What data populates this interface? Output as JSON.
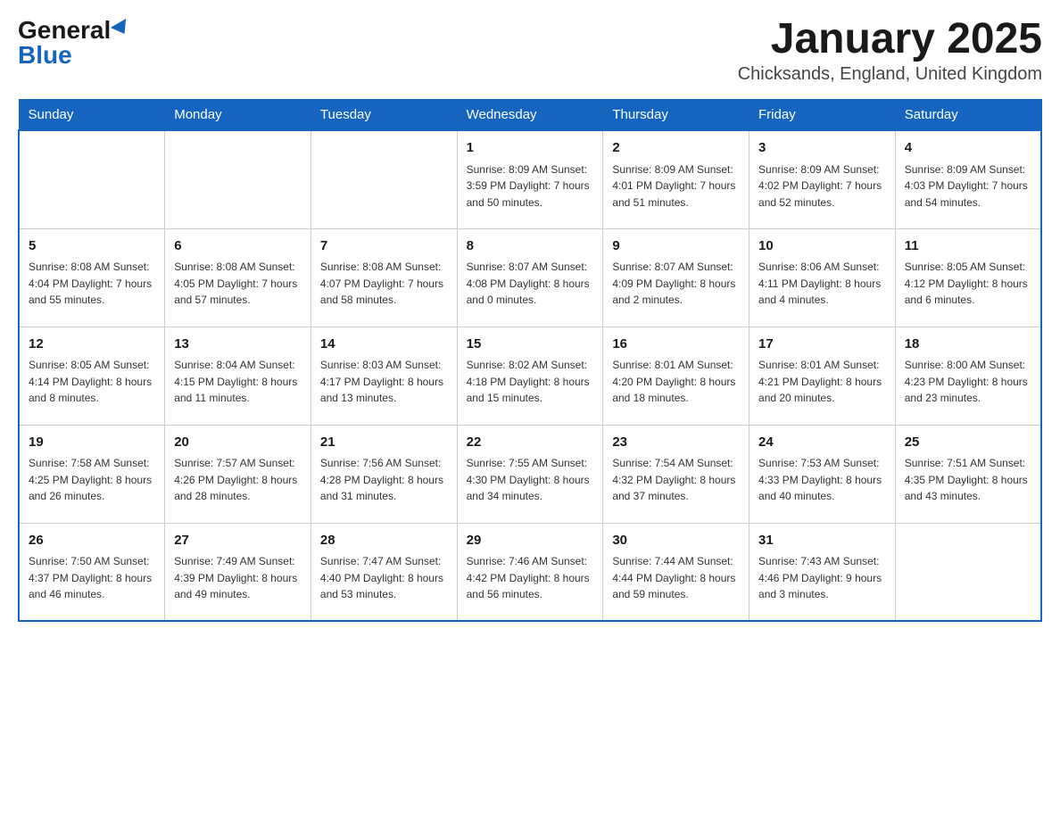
{
  "header": {
    "logo_general": "General",
    "logo_blue": "Blue",
    "month_title": "January 2025",
    "location": "Chicksands, England, United Kingdom"
  },
  "days_of_week": [
    "Sunday",
    "Monday",
    "Tuesday",
    "Wednesday",
    "Thursday",
    "Friday",
    "Saturday"
  ],
  "weeks": [
    [
      {
        "day": "",
        "info": ""
      },
      {
        "day": "",
        "info": ""
      },
      {
        "day": "",
        "info": ""
      },
      {
        "day": "1",
        "info": "Sunrise: 8:09 AM\nSunset: 3:59 PM\nDaylight: 7 hours\nand 50 minutes."
      },
      {
        "day": "2",
        "info": "Sunrise: 8:09 AM\nSunset: 4:01 PM\nDaylight: 7 hours\nand 51 minutes."
      },
      {
        "day": "3",
        "info": "Sunrise: 8:09 AM\nSunset: 4:02 PM\nDaylight: 7 hours\nand 52 minutes."
      },
      {
        "day": "4",
        "info": "Sunrise: 8:09 AM\nSunset: 4:03 PM\nDaylight: 7 hours\nand 54 minutes."
      }
    ],
    [
      {
        "day": "5",
        "info": "Sunrise: 8:08 AM\nSunset: 4:04 PM\nDaylight: 7 hours\nand 55 minutes."
      },
      {
        "day": "6",
        "info": "Sunrise: 8:08 AM\nSunset: 4:05 PM\nDaylight: 7 hours\nand 57 minutes."
      },
      {
        "day": "7",
        "info": "Sunrise: 8:08 AM\nSunset: 4:07 PM\nDaylight: 7 hours\nand 58 minutes."
      },
      {
        "day": "8",
        "info": "Sunrise: 8:07 AM\nSunset: 4:08 PM\nDaylight: 8 hours\nand 0 minutes."
      },
      {
        "day": "9",
        "info": "Sunrise: 8:07 AM\nSunset: 4:09 PM\nDaylight: 8 hours\nand 2 minutes."
      },
      {
        "day": "10",
        "info": "Sunrise: 8:06 AM\nSunset: 4:11 PM\nDaylight: 8 hours\nand 4 minutes."
      },
      {
        "day": "11",
        "info": "Sunrise: 8:05 AM\nSunset: 4:12 PM\nDaylight: 8 hours\nand 6 minutes."
      }
    ],
    [
      {
        "day": "12",
        "info": "Sunrise: 8:05 AM\nSunset: 4:14 PM\nDaylight: 8 hours\nand 8 minutes."
      },
      {
        "day": "13",
        "info": "Sunrise: 8:04 AM\nSunset: 4:15 PM\nDaylight: 8 hours\nand 11 minutes."
      },
      {
        "day": "14",
        "info": "Sunrise: 8:03 AM\nSunset: 4:17 PM\nDaylight: 8 hours\nand 13 minutes."
      },
      {
        "day": "15",
        "info": "Sunrise: 8:02 AM\nSunset: 4:18 PM\nDaylight: 8 hours\nand 15 minutes."
      },
      {
        "day": "16",
        "info": "Sunrise: 8:01 AM\nSunset: 4:20 PM\nDaylight: 8 hours\nand 18 minutes."
      },
      {
        "day": "17",
        "info": "Sunrise: 8:01 AM\nSunset: 4:21 PM\nDaylight: 8 hours\nand 20 minutes."
      },
      {
        "day": "18",
        "info": "Sunrise: 8:00 AM\nSunset: 4:23 PM\nDaylight: 8 hours\nand 23 minutes."
      }
    ],
    [
      {
        "day": "19",
        "info": "Sunrise: 7:58 AM\nSunset: 4:25 PM\nDaylight: 8 hours\nand 26 minutes."
      },
      {
        "day": "20",
        "info": "Sunrise: 7:57 AM\nSunset: 4:26 PM\nDaylight: 8 hours\nand 28 minutes."
      },
      {
        "day": "21",
        "info": "Sunrise: 7:56 AM\nSunset: 4:28 PM\nDaylight: 8 hours\nand 31 minutes."
      },
      {
        "day": "22",
        "info": "Sunrise: 7:55 AM\nSunset: 4:30 PM\nDaylight: 8 hours\nand 34 minutes."
      },
      {
        "day": "23",
        "info": "Sunrise: 7:54 AM\nSunset: 4:32 PM\nDaylight: 8 hours\nand 37 minutes."
      },
      {
        "day": "24",
        "info": "Sunrise: 7:53 AM\nSunset: 4:33 PM\nDaylight: 8 hours\nand 40 minutes."
      },
      {
        "day": "25",
        "info": "Sunrise: 7:51 AM\nSunset: 4:35 PM\nDaylight: 8 hours\nand 43 minutes."
      }
    ],
    [
      {
        "day": "26",
        "info": "Sunrise: 7:50 AM\nSunset: 4:37 PM\nDaylight: 8 hours\nand 46 minutes."
      },
      {
        "day": "27",
        "info": "Sunrise: 7:49 AM\nSunset: 4:39 PM\nDaylight: 8 hours\nand 49 minutes."
      },
      {
        "day": "28",
        "info": "Sunrise: 7:47 AM\nSunset: 4:40 PM\nDaylight: 8 hours\nand 53 minutes."
      },
      {
        "day": "29",
        "info": "Sunrise: 7:46 AM\nSunset: 4:42 PM\nDaylight: 8 hours\nand 56 minutes."
      },
      {
        "day": "30",
        "info": "Sunrise: 7:44 AM\nSunset: 4:44 PM\nDaylight: 8 hours\nand 59 minutes."
      },
      {
        "day": "31",
        "info": "Sunrise: 7:43 AM\nSunset: 4:46 PM\nDaylight: 9 hours\nand 3 minutes."
      },
      {
        "day": "",
        "info": ""
      }
    ]
  ]
}
